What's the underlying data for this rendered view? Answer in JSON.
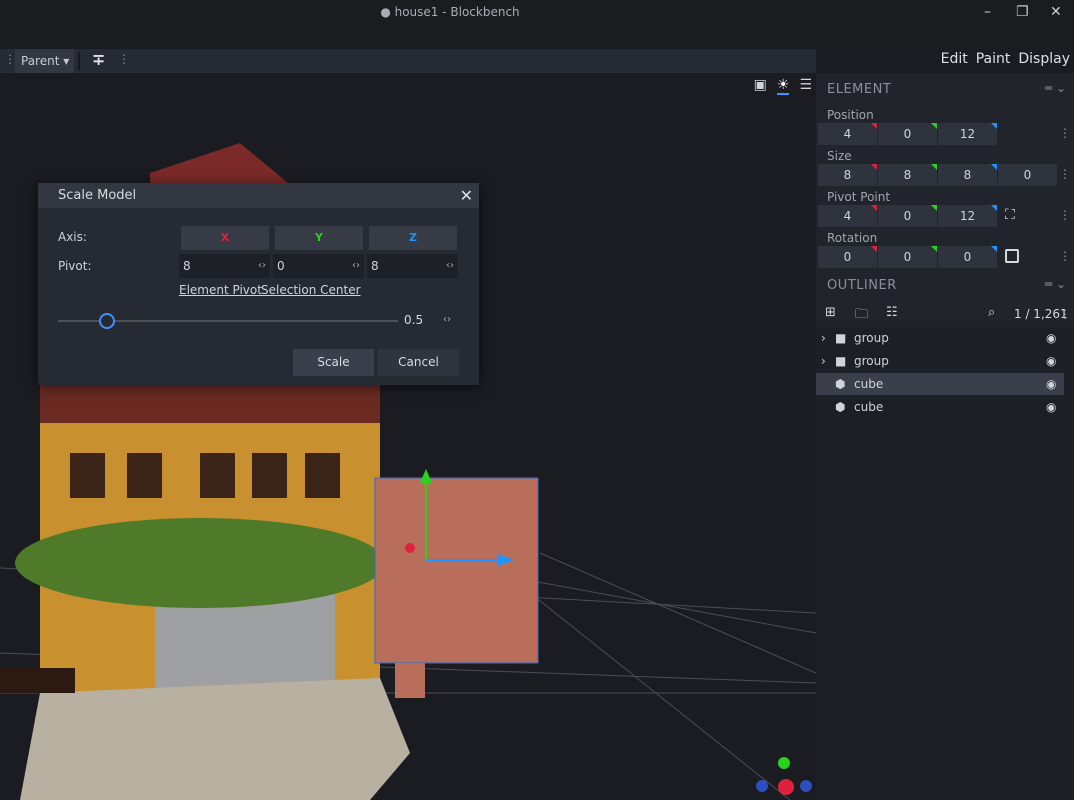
{
  "window": {
    "title": "● house1 - Blockbench",
    "minimize": "–",
    "restore": "❐",
    "close": "✕"
  },
  "toolbar": {
    "transform_space": "Parent ▾",
    "transform_icon": "pivot-axis-icon"
  },
  "mode_tabs": [
    {
      "label": "Edit",
      "active": true
    },
    {
      "label": "Paint",
      "active": false
    },
    {
      "label": "Display",
      "active": false
    }
  ],
  "element_panel": {
    "title": "ELEMENT",
    "position": {
      "label": "Position",
      "values": [
        "4",
        "0",
        "12"
      ]
    },
    "size": {
      "label": "Size",
      "values": [
        "8",
        "8",
        "8",
        "0"
      ]
    },
    "pivot": {
      "label": "Pivot Point",
      "values": [
        "4",
        "0",
        "12"
      ]
    },
    "rotation": {
      "label": "Rotation",
      "values": [
        "0",
        "0",
        "0"
      ]
    }
  },
  "outliner": {
    "title": "OUTLINER",
    "count": "1 / 1,261",
    "items": [
      {
        "type": "group",
        "label": "group",
        "selected": false
      },
      {
        "type": "group",
        "label": "group",
        "selected": false
      },
      {
        "type": "cube",
        "label": "cube",
        "selected": true
      },
      {
        "type": "cube",
        "label": "cube",
        "selected": false
      }
    ]
  },
  "dialog": {
    "title": "Scale Model",
    "axis_label": "Axis:",
    "axes": [
      "X",
      "Y",
      "Z"
    ],
    "pivot_label": "Pivot:",
    "pivot_values": [
      "8",
      "0",
      "8"
    ],
    "link_element_pivot": "Element Pivot",
    "link_selection_center": "Selection Center",
    "scale_value": "0.5",
    "scale_button": "Scale",
    "cancel_button": "Cancel"
  },
  "colors": {
    "x": "#e0213d",
    "y": "#29d31c",
    "z": "#1e92ff",
    "accent": "#3e90ff"
  }
}
